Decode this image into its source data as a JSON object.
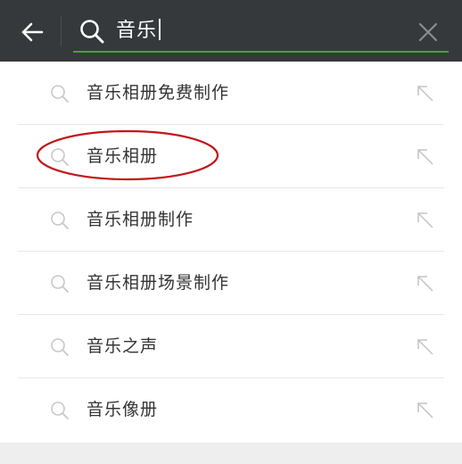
{
  "search": {
    "query": "音乐"
  },
  "suggestions": [
    {
      "label": "音乐相册免费制作"
    },
    {
      "label": "音乐相册"
    },
    {
      "label": "音乐相册制作"
    },
    {
      "label": "音乐相册场景制作"
    },
    {
      "label": "音乐之声"
    },
    {
      "label": "音乐像册"
    }
  ],
  "colors": {
    "topbar": "#36393b",
    "accent_underline": "#45a23f",
    "highlight_ellipse": "#c0161b"
  },
  "icons": {
    "back": "arrow-left-icon",
    "search": "search-icon",
    "clear": "close-icon",
    "suggestion": "search-icon",
    "fill": "arrow-up-left-icon"
  }
}
